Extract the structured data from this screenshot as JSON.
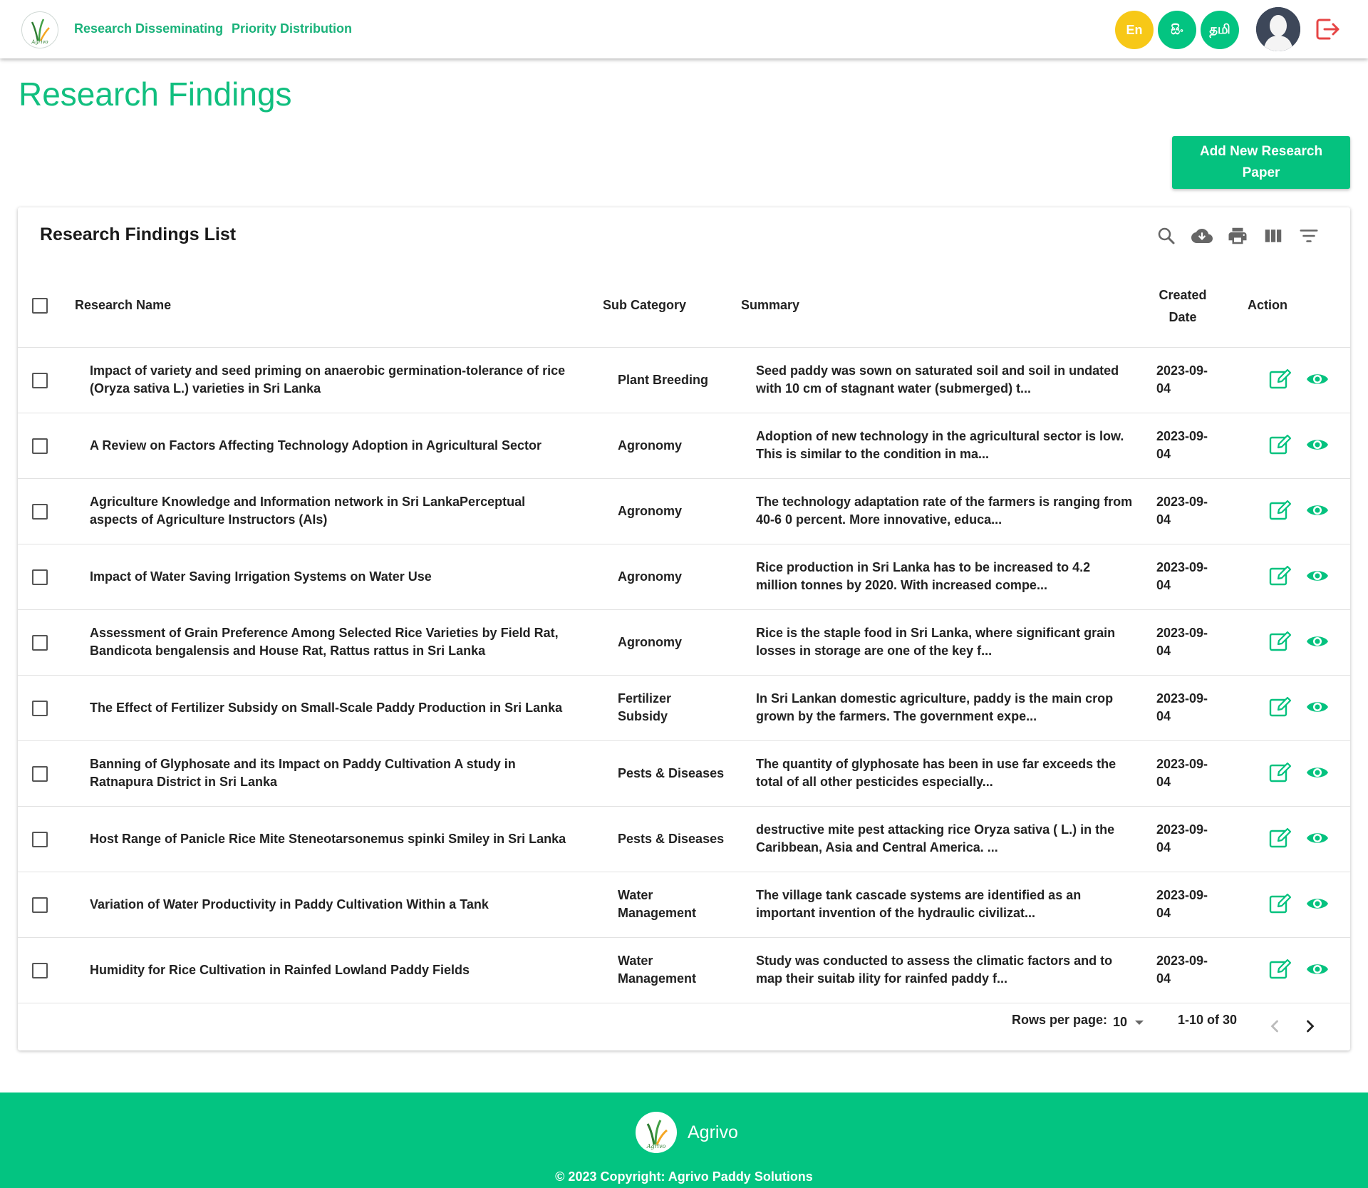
{
  "nav": {
    "logo_text": "Agrivo",
    "links": [
      "Research Disseminating",
      "Priority Distribution"
    ],
    "languages": [
      {
        "label": "En",
        "color": "#f7c817"
      },
      {
        "label": "සිං",
        "color": "#03c481"
      },
      {
        "label": "தமி",
        "color": "#03c481"
      }
    ]
  },
  "page": {
    "title": "Research Findings",
    "add_button": "Add New Research Paper"
  },
  "table": {
    "title": "Research Findings List",
    "columns": [
      "Research Name",
      "Sub Category",
      "Summary",
      "Created Date",
      "Action"
    ],
    "rows": [
      {
        "name": "Impact of variety and seed priming on anaerobic germination-tolerance of rice (Oryza sativa L.) varieties in Sri Lanka",
        "category": "Plant Breeding",
        "summary": "Seed paddy was sown on saturated soil and soil in undated with 10 cm of stagnant water (submerged) t...",
        "date": "2023-09-04"
      },
      {
        "name": "A Review on Factors Affecting Technology Adoption in Agricultural Sector",
        "category": "Agronomy",
        "summary": "Adoption of new technology in the agricultural sector is low. This is similar to the condition in ma...",
        "date": "2023-09-04"
      },
      {
        "name": "Agriculture Knowledge and Information network in Sri LankaPerceptual aspects of Agriculture Instructors (AIs)",
        "category": "Agronomy",
        "summary": "The technology adaptation rate of the farmers is ranging from 40-6 0 percent. More innovative, educa...",
        "date": "2023-09-04"
      },
      {
        "name": "Impact of Water Saving Irrigation Systems on Water Use",
        "category": "Agronomy",
        "summary": "Rice production in Sri Lanka has to be increased to 4.2 million tonnes by 2020. With increased compe...",
        "date": "2023-09-04"
      },
      {
        "name": "Assessment of Grain Preference Among Selected Rice Varieties by Field Rat, Bandicota bengalensis and House Rat, Rattus rattus in Sri Lanka",
        "category": "Agronomy",
        "summary": "Rice is the staple food in Sri Lanka, where significant grain losses in storage are one of the key f...",
        "date": "2023-09-04"
      },
      {
        "name": "The Effect of Fertilizer Subsidy on Small-Scale Paddy Production in Sri Lanka",
        "category": "Fertilizer Subsidy",
        "summary": "In Sri Lankan domestic agriculture, paddy is the main crop grown by the farmers. The government expe...",
        "date": "2023-09-04"
      },
      {
        "name": "Banning of Glyphosate and its Impact on Paddy Cultivation A study in Ratnapura District in Sri Lanka",
        "category": "Pests & Diseases",
        "summary": "The quantity of glyphosate has been in use far exceeds the total of all other pesticides especially...",
        "date": "2023-09-04"
      },
      {
        "name": "Host Range of Panicle Rice Mite Steneotarsonemus spinki Smiley in Sri Lanka",
        "category": "Pests & Diseases",
        "summary": "destructive mite pest attacking rice Oryza sativa ( L.) in the Caribbean, Asia and Central America. ...",
        "date": "2023-09-04"
      },
      {
        "name": "Variation of Water Productivity in Paddy Cultivation Within a Tank",
        "category": "Water Management",
        "summary": "The village tank cascade systems are identified as an important invention of the hydraulic civilizat...",
        "date": "2023-09-04"
      },
      {
        "name": "Humidity for Rice Cultivation in Rainfed Lowland Paddy Fields",
        "category": "Water Management",
        "summary": "Study was conducted to assess the climatic factors and to map their suitab ility for rainfed paddy f...",
        "date": "2023-09-04"
      }
    ],
    "rows_per_page_label": "Rows per page:",
    "rows_per_page_value": "10",
    "range_label": "1-10 of 30"
  },
  "footer": {
    "brand": "Agrivo",
    "copyright": "© 2023 Copyright: Agrivo Paddy Solutions"
  },
  "colors": {
    "accent": "#03c481",
    "title_green": "#11bf7f",
    "logout_red": "#e64545",
    "lang_yellow": "#f7c817"
  },
  "icons": [
    "search-icon",
    "cloud-download-icon",
    "print-icon",
    "view-column-icon",
    "filter-list-icon",
    "edit-icon",
    "eye-icon",
    "logout-icon",
    "chevron-left-icon",
    "chevron-right-icon",
    "dropdown-arrow-icon"
  ]
}
